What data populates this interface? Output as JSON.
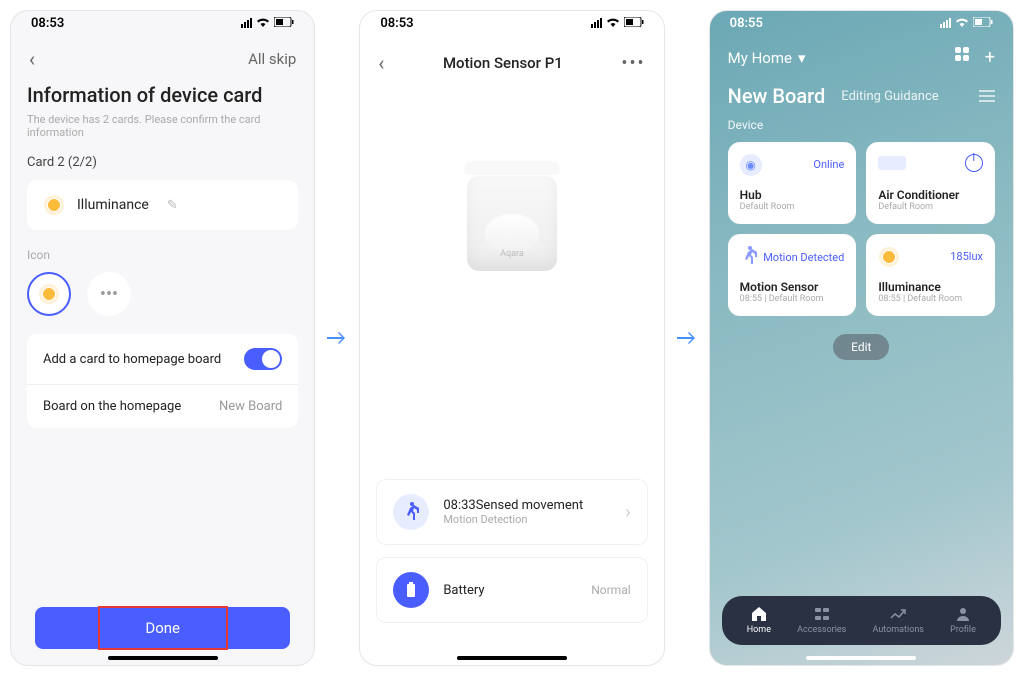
{
  "screen1": {
    "time": "08:53",
    "nav_action": "All skip",
    "title": "Information of device card",
    "subtitle": "The device has 2 cards. Please confirm the card information",
    "card_label": "Card 2 (2/2)",
    "card_name": "Illuminance",
    "icon_label": "Icon",
    "setting1_label": "Add a card to homepage board",
    "setting2_label": "Board on the homepage",
    "setting2_value": "New Board",
    "done_label": "Done"
  },
  "screen2": {
    "time": "08:53",
    "title": "Motion Sensor P1",
    "brand": "Aqara",
    "motion_title": "08:33Sensed movement",
    "motion_sub": "Motion Detection",
    "battery_label": "Battery",
    "battery_value": "Normal"
  },
  "screen3": {
    "time": "08:55",
    "home_label": "My Home",
    "board_name": "New Board",
    "board_sub": "Editing Guidance",
    "section_title": "Device",
    "devices": {
      "hub_name": "Hub",
      "hub_room": "Default Room",
      "hub_status": "Online",
      "ac_name": "Air Conditioner",
      "ac_room": "Default Room",
      "motion_name": "Motion Sensor",
      "motion_room": "08:55 | Default Room",
      "motion_status": "Motion Detected",
      "illum_name": "Illuminance",
      "illum_room": "08:55 | Default Room",
      "illum_value": "185lux"
    },
    "edit_label": "Edit",
    "nav": {
      "home": "Home",
      "accessories": "Accessories",
      "automations": "Automations",
      "profile": "Profile"
    }
  }
}
